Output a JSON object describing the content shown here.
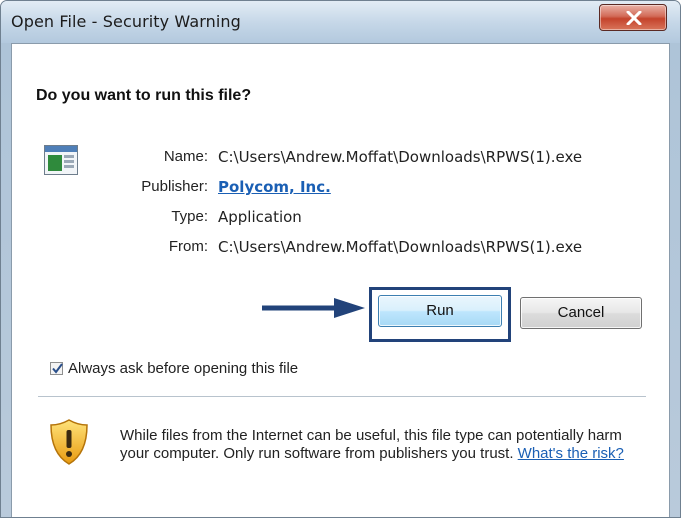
{
  "window": {
    "title": "Open File - Security Warning",
    "close_icon": "close-x-icon"
  },
  "dialog": {
    "question": "Do you want to run this file?",
    "app_icon": "application-window-icon",
    "fields": {
      "name_label": "Name:",
      "name_value": "C:\\Users\\Andrew.Moffat\\Downloads\\RPWS(1).exe",
      "publisher_label": "Publisher:",
      "publisher_value": "Polycom, Inc.",
      "type_label": "Type:",
      "type_value": "Application",
      "from_label": "From:",
      "from_value": "C:\\Users\\Andrew.Moffat\\Downloads\\RPWS(1).exe"
    },
    "buttons": {
      "run_label": "Run",
      "cancel_label": "Cancel"
    },
    "annotation_arrow": "arrow-right-icon",
    "checkbox": {
      "label": "Always ask before opening this file",
      "checked": true
    },
    "warning": {
      "icon": "warning-shield-icon",
      "text": "While files from the Internet can be useful, this file type can potentially harm your computer. Only run software from publishers you trust.",
      "link": "What's the risk?"
    }
  },
  "colors": {
    "link": "#1a5fb4",
    "focus_box": "#22437a",
    "close_button": "#c4432c"
  }
}
